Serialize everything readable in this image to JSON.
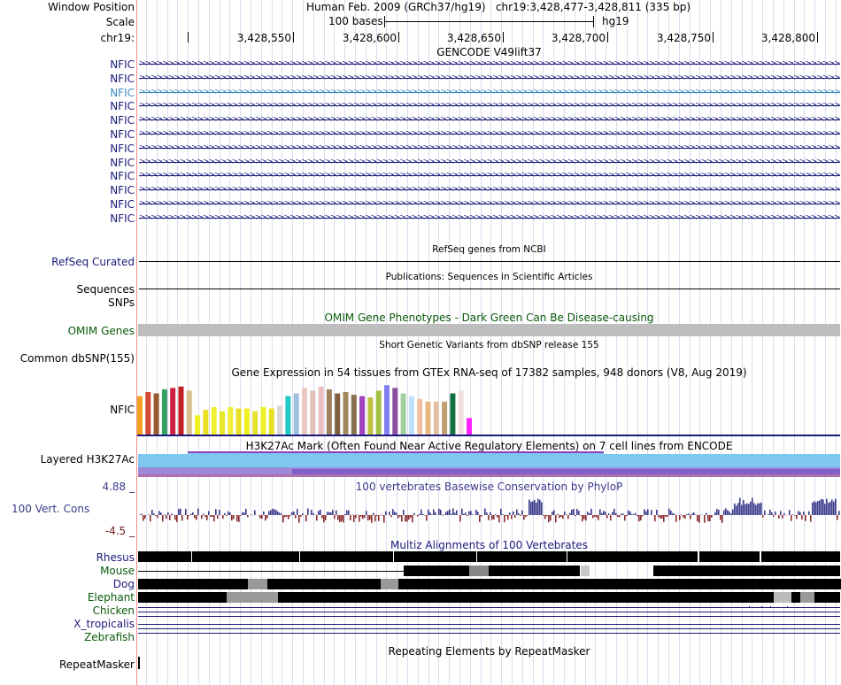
{
  "header": {
    "window_position_label": "Window Position",
    "window_position_value": "Human Feb. 2009 (GRCh37/hg19)   chr19:3,428,477-3,428,811 (335 bp)",
    "scale_label": "Scale",
    "scale_bar_label": "100 bases",
    "scale_assembly": "hg19",
    "chrom_label": "chr19:",
    "ruler_ticks": [
      "3,428,550",
      "3,428,600",
      "3,428,650",
      "3,428,700",
      "3,428,750",
      "3,428,800"
    ]
  },
  "gencode": {
    "title": "GENCODE V49lift37",
    "genes": [
      "NFIC",
      "NFIC",
      "NFIC",
      "NFIC",
      "NFIC",
      "NFIC",
      "NFIC",
      "NFIC",
      "NFIC",
      "NFIC",
      "NFIC",
      "NFIC"
    ],
    "gene_color": "#1a1a7a",
    "highlight_color": "#3a8abf"
  },
  "refseq": {
    "title": "RefSeq genes from NCBI",
    "label": "RefSeq Curated"
  },
  "publications": {
    "title": "Publications: Sequences in Scientific Articles",
    "label": "Sequences"
  },
  "snps": {
    "label": "SNPs"
  },
  "omim": {
    "title": "OMIM Gene Phenotypes - Dark Green Can Be Disease-causing",
    "label": "OMIM Genes",
    "color": "#0a5a0a"
  },
  "dbsnp": {
    "title": "Short Genetic Variants from dbSNP release 155",
    "label": "Common dbSNP(155)"
  },
  "gtex": {
    "title": "Gene Expression in 54 tissues from GTEx RNA-seq of 17382 samples, 948 donors (V8, Aug 2019)",
    "label": "NFIC"
  },
  "h3k27ac": {
    "title": "H3K27Ac Mark (Often Found Near Active Regulatory Elements) on 7 cell lines from ENCODE",
    "label": "Layered H3K27Ac"
  },
  "conservation": {
    "title": "100 vertebrates Basewise Conservation by PhyloP",
    "label": "100 Vert. Cons",
    "max_label": "4.88 _",
    "min_label": "-4.5 _",
    "color": "#3a3a8a"
  },
  "multiz": {
    "title": "Multiz Alignments of 100 Vertebrates",
    "species": [
      {
        "name": "Rhesus",
        "color": "#1a1a7a"
      },
      {
        "name": "Mouse",
        "color": "#0a5a0a"
      },
      {
        "name": "Dog",
        "color": "#1a1a7a"
      },
      {
        "name": "Elephant",
        "color": "#0a5a0a"
      },
      {
        "name": "Chicken",
        "color": "#0a5a0a"
      },
      {
        "name": "X_tropicalis",
        "color": "#1a1a7a"
      },
      {
        "name": "Zebrafish",
        "color": "#0a5a0a"
      }
    ]
  },
  "repeatmasker": {
    "title": "Repeating Elements by RepeatMasker",
    "label": "RepeatMasker"
  }
}
